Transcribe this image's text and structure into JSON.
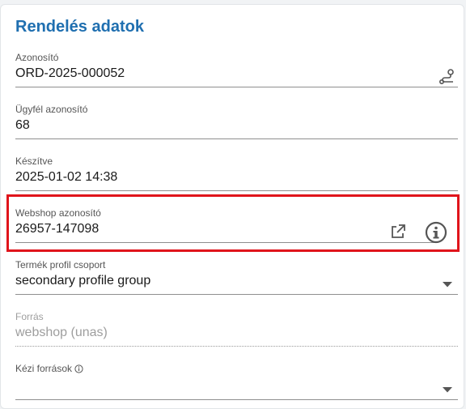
{
  "card": {
    "title": "Rendelés adatok"
  },
  "fields": {
    "azonosito": {
      "label": "Azonosító",
      "value": "ORD-2025-000052"
    },
    "ugyfel": {
      "label": "Ügyfél azonosító",
      "value": "68"
    },
    "keszitve": {
      "label": "Készítve",
      "value": "2025-01-02 14:38"
    },
    "webshop": {
      "label": "Webshop azonosító",
      "value": "26957-147098"
    },
    "termek_profil": {
      "label": "Termék profil csoport",
      "value": "secondary profile group"
    },
    "forras": {
      "label": "Forrás",
      "value": "webshop (unas)"
    },
    "kezi_forrasok": {
      "label": "Kézi források",
      "value": ""
    }
  },
  "icons": {
    "azonosito": "route-icon",
    "webshop_open": "external-link-icon",
    "webshop_info": "info-circle-icon",
    "termek_dropdown": "caret-down-icon",
    "kezi_info": "info-icon",
    "kezi_dropdown": "caret-down-icon"
  },
  "colors": {
    "title": "#1f6fb0",
    "highlight": "#e0141b"
  }
}
